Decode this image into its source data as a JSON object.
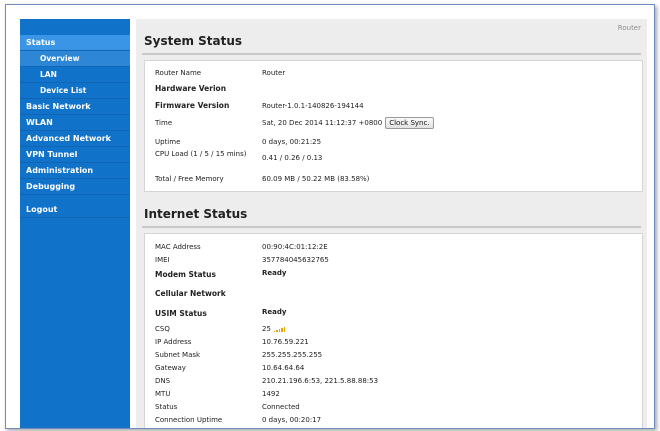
{
  "sidebar": {
    "items": [
      {
        "label": "Status"
      },
      {
        "label": "Overview"
      },
      {
        "label": "LAN"
      },
      {
        "label": "Device List"
      },
      {
        "label": "Basic Network"
      },
      {
        "label": "WLAN"
      },
      {
        "label": "Advanced Network"
      },
      {
        "label": "VPN Tunnel"
      },
      {
        "label": "Administration"
      },
      {
        "label": "Debugging"
      }
    ],
    "logout": "Logout"
  },
  "header": {
    "router_tag": "Router"
  },
  "system": {
    "title": "System Status",
    "rows": [
      {
        "label": "Router Name",
        "value": "Router"
      },
      {
        "label": "Hardware Verion",
        "value": ""
      },
      {
        "label": "Firmware Version",
        "value": "Router-1.0.1-140826-194144"
      },
      {
        "label": "Time",
        "value": "Sat, 20 Dec 2014 11:12:37 +0800"
      },
      {
        "label": "Uptime",
        "value": "0 days, 00:21:25"
      },
      {
        "label": "CPU Load (1 / 5 / 15 mins)",
        "value": "0.41 / 0.26 / 0.13"
      },
      {
        "label": "Total / Free Memory",
        "value": "60.09 MB / 50.22 MB (83.58%)"
      }
    ],
    "clock_sync_label": "Clock Sync."
  },
  "internet": {
    "title": "Internet Status",
    "rows": [
      {
        "label": "MAC Address",
        "value": "00:90:4C:01:12:2E"
      },
      {
        "label": "IMEI",
        "value": "357784045632765"
      },
      {
        "label": "Modem Status",
        "value": "Ready"
      },
      {
        "label": "Cellular Network",
        "value": ""
      },
      {
        "label": "USIM Status",
        "value": "Ready"
      },
      {
        "label": "CSQ",
        "value": "25"
      },
      {
        "label": "IP Address",
        "value": "10.76.59.221"
      },
      {
        "label": "Subnet Mask",
        "value": "255.255.255.255"
      },
      {
        "label": "Gateway",
        "value": "10.64.64.64"
      },
      {
        "label": "DNS",
        "value": "210.21.196.6:53, 221.5.88.88:53"
      },
      {
        "label": "MTU",
        "value": "1492"
      },
      {
        "label": "Status",
        "value": "Connected"
      },
      {
        "label": "Connection Uptime",
        "value": "0 days, 00:20:17"
      }
    ]
  },
  "colors": {
    "sidebar_bg": "#1172c9",
    "sidebar_active": "#3a95e6",
    "content_bg": "#ededed",
    "signal": "#e8a400"
  },
  "icons": {
    "csq_signal": "signal-bars-icon"
  }
}
